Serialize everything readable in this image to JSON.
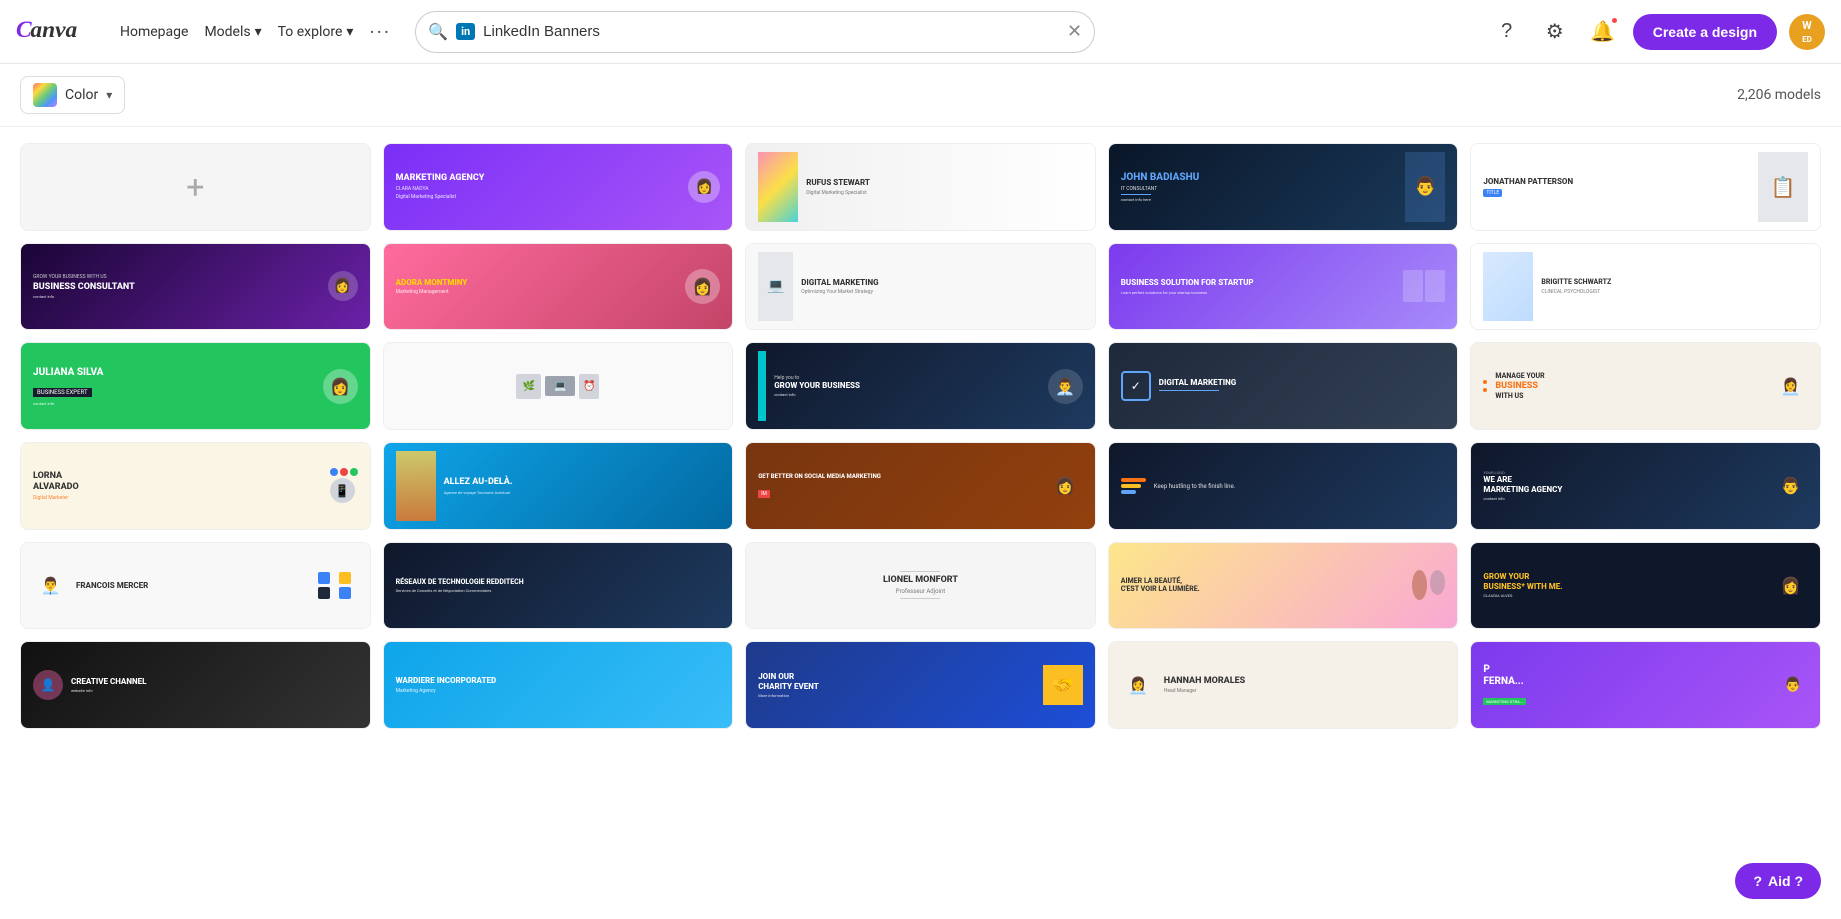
{
  "header": {
    "logo": "Canva",
    "nav": [
      {
        "label": "Homepage"
      },
      {
        "label": "Models",
        "dropdown": true
      },
      {
        "label": "To explore",
        "dropdown": true
      }
    ],
    "search": {
      "placeholder": "LinkedIn Banners",
      "value": "LinkedIn Banners",
      "badge": "in"
    },
    "create_label": "Create a design",
    "avatar_initials": "W\nED"
  },
  "toolbar": {
    "filter_label": "Color",
    "models_count": "2,206 models"
  },
  "grid": {
    "blank_card": "+",
    "templates": [
      {
        "id": "marketing-agency",
        "title": "MARKETING AGENCY",
        "subtitle": "CLARA NADYA",
        "style": "b-marketing-agency"
      },
      {
        "id": "rufus",
        "title": "RUFUS STEWART",
        "subtitle": "Digital Marketing Specialist",
        "style": "b-rufus"
      },
      {
        "id": "john",
        "title": "John Badiashu",
        "subtitle": "IT CONSULTANT",
        "style": "b-john"
      },
      {
        "id": "jonathan",
        "title": "JONATHAN PATTERSON",
        "subtitle": "",
        "style": "b-jonathan"
      },
      {
        "id": "business-consultant",
        "title": "BUSINESS CONSULTANT",
        "subtitle": "Grow your business with us",
        "style": "b-business-consultant"
      },
      {
        "id": "adora",
        "title": "ADORA MONTMINY",
        "subtitle": "Marketing Management",
        "style": "b-adora"
      },
      {
        "id": "digital-marketing",
        "title": "DIGITAL MARKETING",
        "subtitle": "Optimizing Your Market Strategy",
        "style": "b-digital-marketing"
      },
      {
        "id": "business-solution",
        "title": "Business Solution For Startup",
        "subtitle": "",
        "style": "b-business-solution"
      },
      {
        "id": "brigitte",
        "title": "BRIGITTE SCHWARTZ",
        "subtitle": "CLINICAL PSYCHOLOGIST",
        "style": "b-brigitte"
      },
      {
        "id": "juliana",
        "title": "JULIANA SILVA",
        "subtitle": "BUSINESS EXPERT",
        "style": "b-juliana"
      },
      {
        "id": "minimal-desk",
        "title": "",
        "subtitle": "",
        "style": "b-minimal-desk"
      },
      {
        "id": "grow-business",
        "title": "GROW YOUR BUSINESS",
        "subtitle": "Help you to",
        "style": "b-grow-business"
      },
      {
        "id": "digital-mktg2",
        "title": "DIGITAL MARKETING",
        "subtitle": "",
        "style": "b-digital-mktg2"
      },
      {
        "id": "manage-biz",
        "title": "MANAGE YOUR BUSINESS WITH US",
        "subtitle": "",
        "style": "b-manage-biz"
      },
      {
        "id": "lorna",
        "title": "LORNA ALVARADO",
        "subtitle": "Digital Marketer",
        "style": "b-lorna"
      },
      {
        "id": "allez",
        "title": "Allez Au-Delà.",
        "subtitle": "Agence de voyage Tourisme Aventure",
        "style": "b-allez"
      },
      {
        "id": "get-better",
        "title": "GET BETTER ON SOCIAL MEDIA MARKETING",
        "subtitle": "",
        "style": "b-get-better"
      },
      {
        "id": "hustling",
        "title": "Keep hustling to the finish line.",
        "subtitle": "",
        "style": "b-hustling"
      },
      {
        "id": "marketing-agency2",
        "title": "WE ARE MARKETING AGENCY",
        "subtitle": "YOUR LOGO",
        "style": "b-marketing-agency2"
      },
      {
        "id": "francois",
        "title": "Francois Mercer",
        "subtitle": "",
        "style": "b-francois"
      },
      {
        "id": "reseaux",
        "title": "Réseaux de Technologie Redditech",
        "subtitle": "Services de Conseils et de Négociation Commerciales",
        "style": "b-reseaux"
      },
      {
        "id": "lionel",
        "title": "Lionel Monfort",
        "subtitle": "Professeur Adjoint",
        "style": "b-lionel"
      },
      {
        "id": "aimer",
        "title": "Aimer la beauté, c'est voir la lumière.",
        "subtitle": "",
        "style": "b-aimer"
      },
      {
        "id": "grow-biz",
        "title": "GROW YOUR BUSINESS* WITH ME.",
        "subtitle": "CLAUDIA ALVES",
        "style": "b-grow-biz"
      },
      {
        "id": "creative",
        "title": "Creative Channel",
        "subtitle": "",
        "style": "b-creative"
      },
      {
        "id": "wardiere",
        "title": "WARDIERE INCORPORATED",
        "subtitle": "Marketing Agency",
        "style": "b-wardiere"
      },
      {
        "id": "charity",
        "title": "Join Our CHARITY EVENT",
        "subtitle": "",
        "style": "b-charity"
      },
      {
        "id": "hannah",
        "title": "Hannah Morales",
        "subtitle": "Head Manager",
        "style": "b-hannah"
      },
      {
        "id": "fernando",
        "title": "P Fernando",
        "subtitle": "MARKETING STRA...",
        "style": "b-fernando"
      }
    ]
  },
  "aid": {
    "label": "Aid ?",
    "icon": "❓"
  }
}
